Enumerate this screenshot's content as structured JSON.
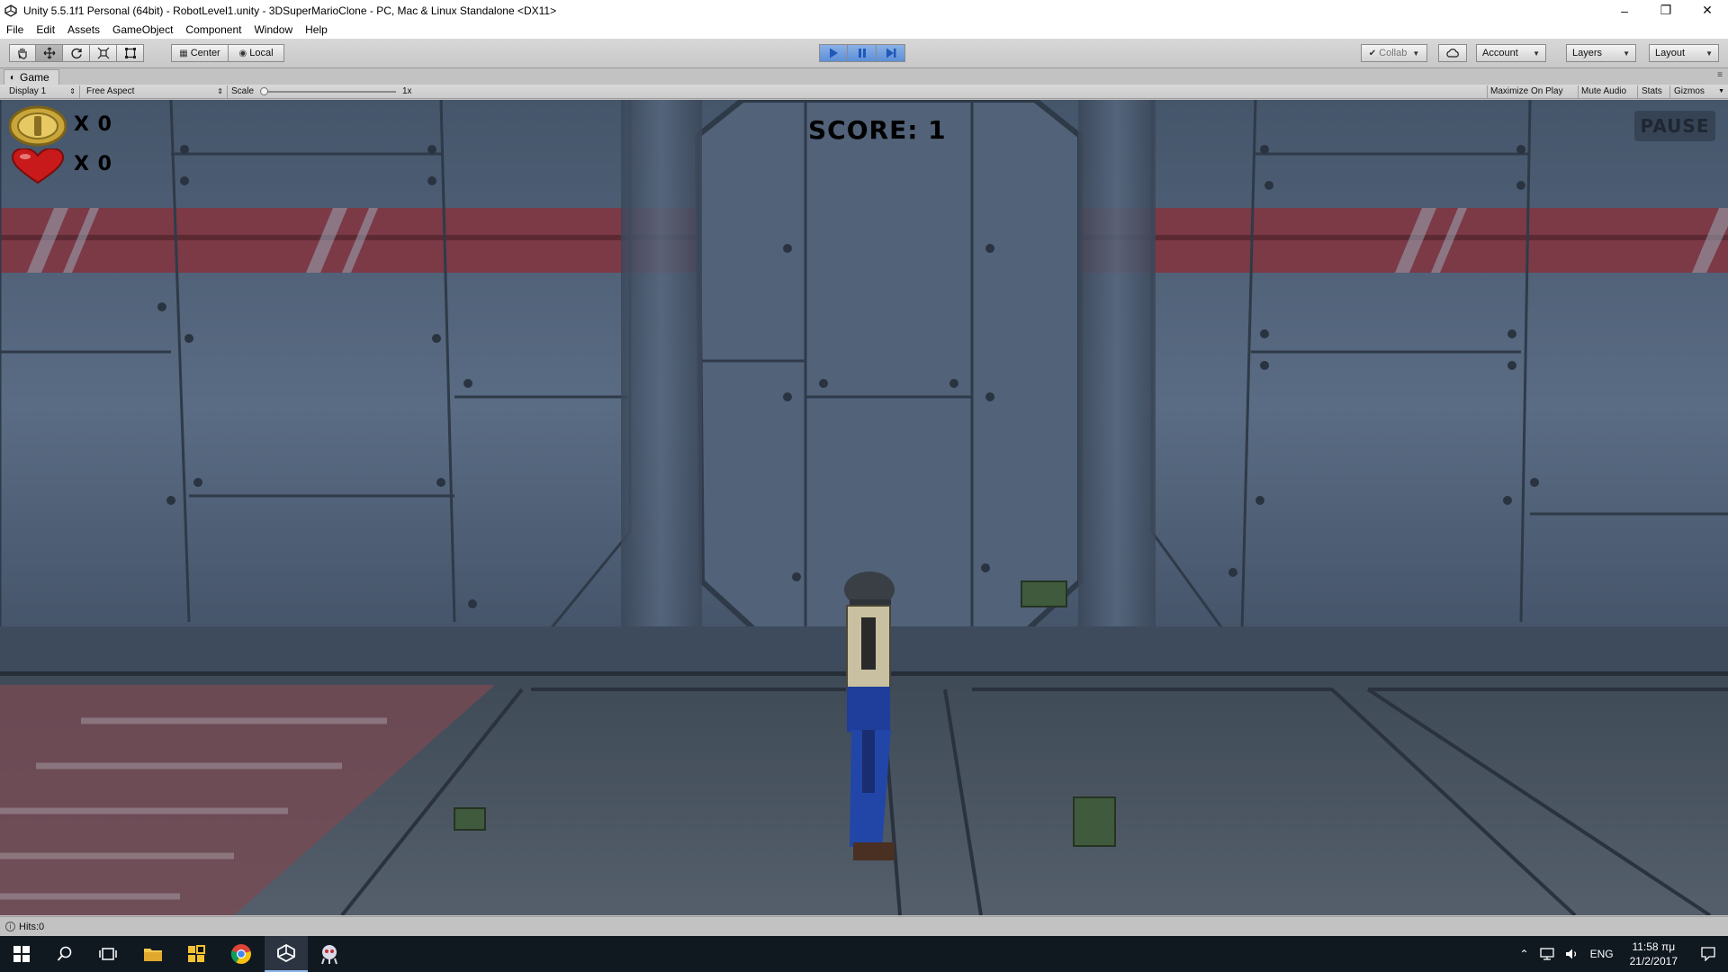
{
  "window": {
    "title": "Unity 5.5.1f1 Personal (64bit) - RobotLevel1.unity - 3DSuperMarioClone - PC, Mac & Linux Standalone <DX11>",
    "controls": [
      "minimize-icon",
      "restore-icon",
      "close-icon"
    ]
  },
  "menu": {
    "items": [
      "File",
      "Edit",
      "Assets",
      "GameObject",
      "Component",
      "Window",
      "Help"
    ]
  },
  "toolbar": {
    "tools": [
      "hand-tool-icon",
      "move-tool-icon",
      "rotate-tool-icon",
      "scale-tool-icon",
      "rect-tool-icon"
    ],
    "pivot_label": "Center",
    "space_label": "Local",
    "play": [
      "play-icon",
      "pause-icon",
      "step-icon"
    ],
    "collab_label": "Collab",
    "account_label": "Account",
    "layers_label": "Layers",
    "layout_label": "Layout"
  },
  "game_view": {
    "tab_label": "Game",
    "display_label": "Display 1",
    "aspect_label": "Free Aspect",
    "scale_label": "Scale",
    "scale_value": "1x",
    "scale_fraction": 0,
    "maximize_label": "Maximize On Play",
    "mute_label": "Mute Audio",
    "stats_label": "Stats",
    "gizmos_label": "Gizmos"
  },
  "hud": {
    "coin_count": "X 0",
    "life_count": "X 0",
    "score": "SCORE: 1",
    "pause_label": "PAUSE"
  },
  "status": {
    "message": "Hits:0"
  },
  "taskbar": {
    "icons": [
      "windows-start-icon",
      "search-icon",
      "task-view-icon",
      "file-explorer-icon",
      "app-yellow-icon",
      "chrome-icon",
      "unity-icon",
      "mascot-app-icon"
    ],
    "language": "ENG",
    "time": "11:58 πμ",
    "date": "21/2/2017"
  },
  "colors": {
    "accent_play": "#5d8fd8",
    "viewport_bg": "#4f6178",
    "stripe_red": "#8a3a44",
    "taskbar_bg": "#101820"
  }
}
